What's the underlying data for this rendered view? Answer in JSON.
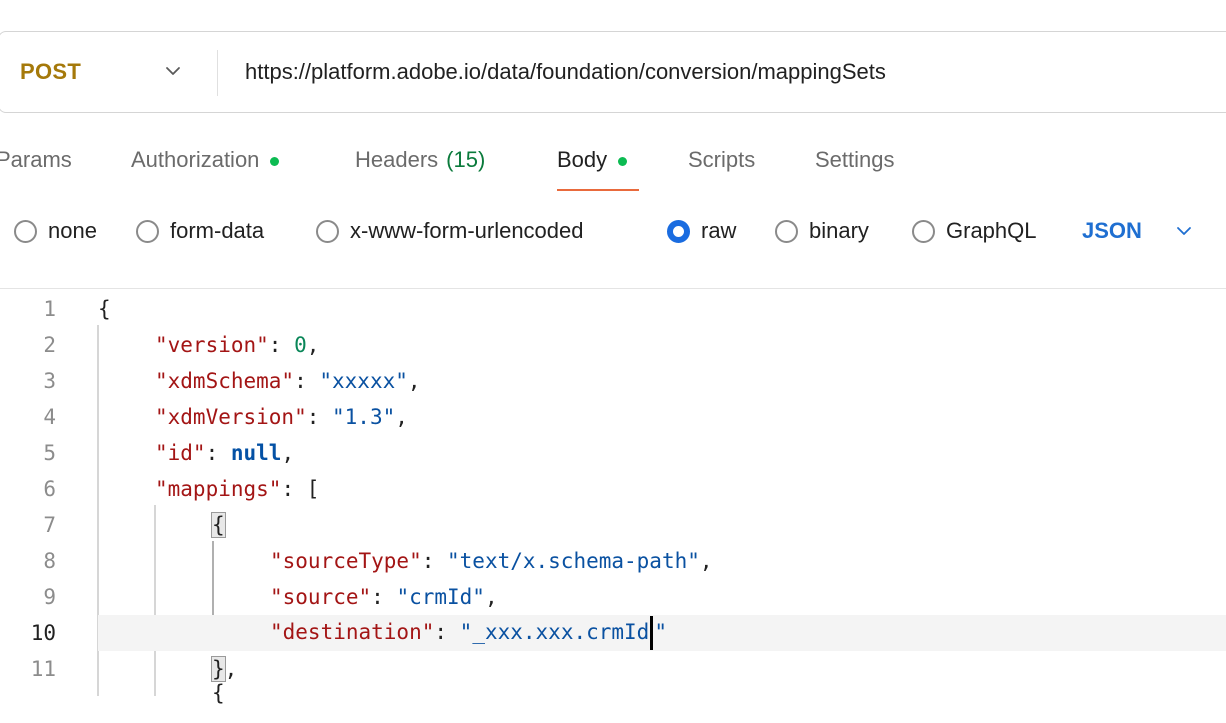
{
  "request": {
    "method": "POST",
    "url": "https://platform.adobe.io/data/foundation/conversion/mappingSets"
  },
  "tabs": [
    {
      "label": "Params"
    },
    {
      "label": "Authorization",
      "dot": true
    },
    {
      "label": "Headers",
      "count": "(15)"
    },
    {
      "label": "Body",
      "dot": true,
      "active": true
    },
    {
      "label": "Scripts"
    },
    {
      "label": "Settings"
    }
  ],
  "body_types": [
    {
      "label": "none",
      "checked": false
    },
    {
      "label": "form-data",
      "checked": false
    },
    {
      "label": "x-www-form-urlencoded",
      "checked": false
    },
    {
      "label": "raw",
      "checked": true
    },
    {
      "label": "binary",
      "checked": false
    },
    {
      "label": "GraphQL",
      "checked": false
    }
  ],
  "format": "JSON",
  "editor": {
    "current_line": 10,
    "lines": [
      {
        "n": "1",
        "text": "{"
      },
      {
        "n": "2",
        "text": "\"version\": 0,"
      },
      {
        "n": "3",
        "text": "\"xdmSchema\": \"xxxxx\","
      },
      {
        "n": "4",
        "text": "\"xdmVersion\": \"1.3\","
      },
      {
        "n": "5",
        "text": "\"id\": null,"
      },
      {
        "n": "6",
        "text": "\"mappings\": ["
      },
      {
        "n": "7",
        "text": "{"
      },
      {
        "n": "8",
        "text": "\"sourceType\": \"text/x.schema-path\","
      },
      {
        "n": "9",
        "text": "\"source\": \"crmId\","
      },
      {
        "n": "10",
        "text": "\"destination\": \"_xxx.xxx.crmId\""
      },
      {
        "n": "11",
        "text": "},"
      }
    ]
  },
  "colors": {
    "method": "#a5790a",
    "dot": "#0cbb52",
    "tab_underline": "#e96a3c",
    "radio_checked": "#1a6ce0",
    "json_key": "#a31515",
    "json_string": "#0a51a1",
    "json_number": "#098658"
  }
}
